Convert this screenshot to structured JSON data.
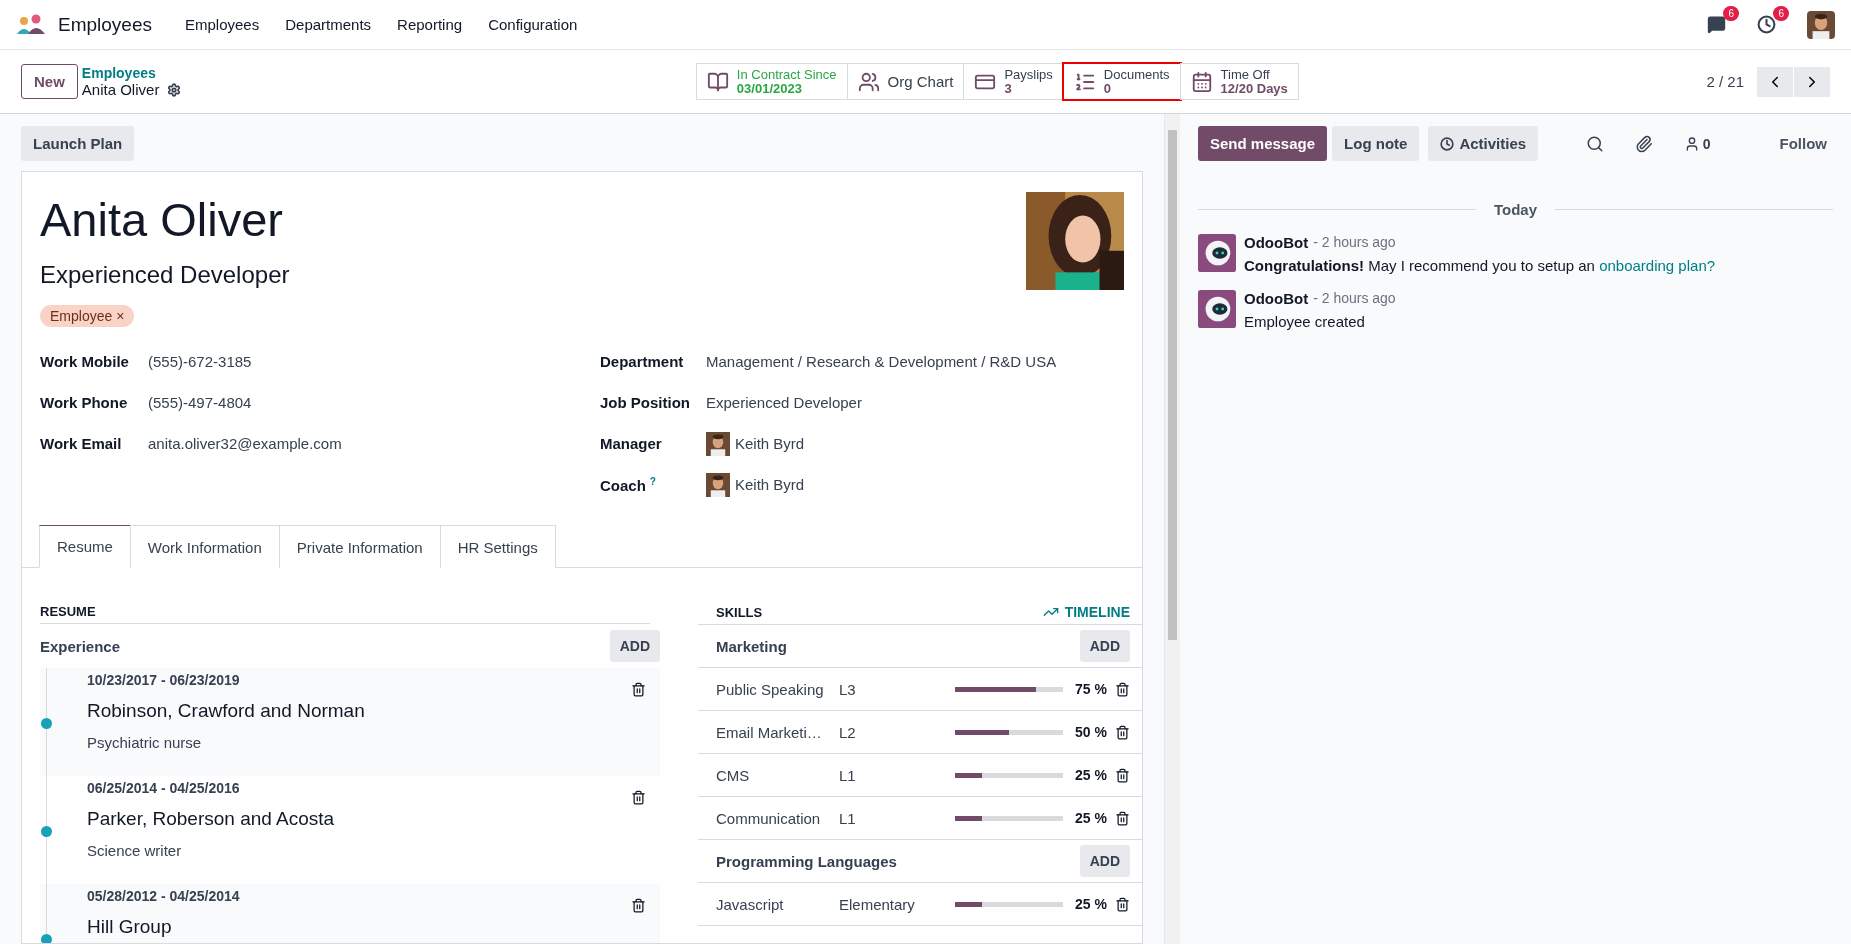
{
  "navbar": {
    "app_name": "Employees",
    "menu": [
      "Employees",
      "Departments",
      "Reporting",
      "Configuration"
    ],
    "messages_count": "6",
    "activities_count": "6"
  },
  "control_panel": {
    "new_button": "New",
    "breadcrumb": "Employees",
    "record_name": "Anita Oliver",
    "pager": "2 / 21",
    "smart_buttons": [
      {
        "kind": "book",
        "label": "In Contract Since",
        "value": "03/01/2023",
        "highlighted": false
      },
      {
        "kind": "people",
        "label": "Org Chart",
        "highlighted": false
      },
      {
        "kind": "card",
        "label": "Payslips",
        "value": "3",
        "highlighted": false
      },
      {
        "kind": "list",
        "label": "Documents",
        "value": "0",
        "highlighted": true
      },
      {
        "kind": "calendar",
        "label": "Time Off",
        "value": "12/20 Days",
        "highlighted": false
      }
    ]
  },
  "form": {
    "action_button": "Launch Plan",
    "name": "Anita Oliver",
    "job_title": "Experienced Developer",
    "tag": "Employee",
    "tag_remove": "×",
    "left_fields": [
      {
        "label": "Work Mobile",
        "value": "(555)-672-3185"
      },
      {
        "label": "Work Phone",
        "value": "(555)-497-4804"
      },
      {
        "label": "Work Email",
        "value": "anita.oliver32@example.com"
      }
    ],
    "right_fields": [
      {
        "label": "Department",
        "value": "Management / Research & Development / R&D USA",
        "kind": "text"
      },
      {
        "label": "Job Position",
        "value": "Experienced Developer",
        "kind": "text"
      },
      {
        "label": "Manager",
        "value": "Keith Byrd",
        "kind": "user"
      },
      {
        "label": "Coach",
        "help": "?",
        "value": "Keith Byrd",
        "kind": "user"
      }
    ],
    "tabs": [
      {
        "label": "Resume",
        "selected": true
      },
      {
        "label": "Work Information",
        "selected": false
      },
      {
        "label": "Private Information",
        "selected": false
      },
      {
        "label": "HR Settings",
        "selected": false
      }
    ],
    "resume": {
      "title": "RESUME",
      "group": "Experience",
      "add": "ADD",
      "entries": [
        {
          "dates": "10/23/2017 - 06/23/2019",
          "company": "Robinson, Crawford and Norman",
          "role": "Psychiatric nurse"
        },
        {
          "dates": "06/25/2014 - 04/25/2016",
          "company": "Parker, Roberson and Acosta",
          "role": "Science writer"
        },
        {
          "dates": "05/28/2012 - 04/25/2014",
          "company": "Hill Group"
        }
      ]
    },
    "skills": {
      "title": "SKILLS",
      "timeline": "TIMELINE",
      "groups": [
        {
          "name": "Marketing",
          "add": "ADD",
          "items": [
            {
              "skill": "Public Speaking",
              "level_name": "L3",
              "level": 0.75,
              "percent": "75 %"
            },
            {
              "skill": "Email Marketi…",
              "level_name": "L2",
              "level": 0.5,
              "percent": "50 %"
            },
            {
              "skill": "CMS",
              "level_name": "L1",
              "level": 0.25,
              "percent": "25 %"
            },
            {
              "skill": "Communication",
              "level_name": "L1",
              "level": 0.25,
              "percent": "25 %"
            }
          ]
        },
        {
          "name": "Programming Languages",
          "add": "ADD",
          "items": [
            {
              "skill": "Javascript",
              "level_name": "Elementary",
              "level": 0.25,
              "percent": "25 %"
            }
          ]
        }
      ]
    }
  },
  "chatter": {
    "send_message": "Send message",
    "log_note": "Log note",
    "activities": "Activities",
    "followers_count": "0",
    "follow": "Follow",
    "date_separator": "Today",
    "messages": [
      {
        "author": "OdooBot",
        "time": "- 2 hours ago",
        "body": "**Congratulations!** May I recommend you to setup an",
        "link": "onboarding plan?"
      },
      {
        "author": "OdooBot",
        "time": "- 2 hours ago",
        "body": "Employee created"
      }
    ]
  }
}
